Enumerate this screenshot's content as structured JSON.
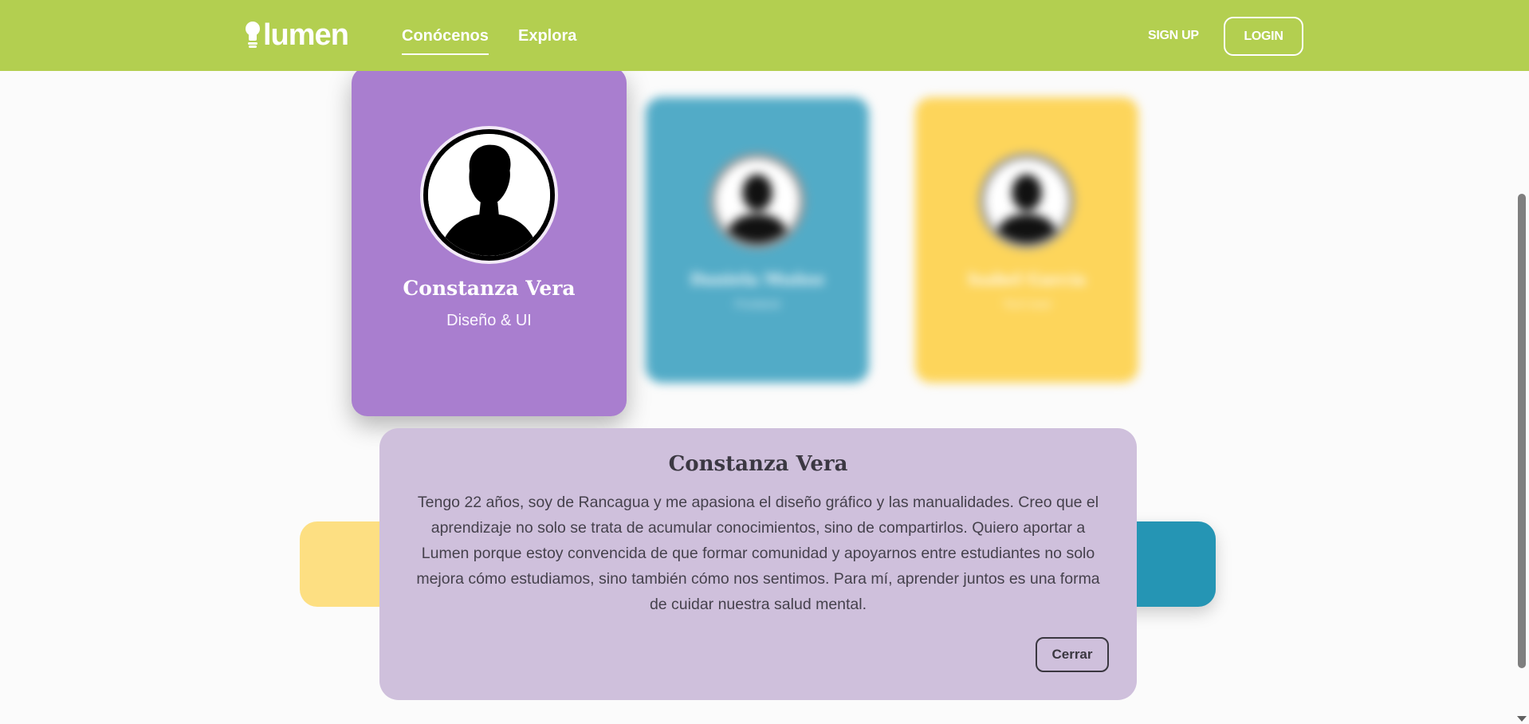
{
  "header": {
    "logo_text": "lumen",
    "nav": [
      {
        "label": "Conócenos",
        "active": true
      },
      {
        "label": "Explora",
        "active": false
      }
    ],
    "signup_label": "SIGN UP",
    "login_label": "LOGIN",
    "color": "#b3cf50"
  },
  "team": [
    {
      "name": "Constanza Vera",
      "role": "Diseño & UI",
      "color": "#a97ecf",
      "selected": true
    },
    {
      "name": "Daniela Muñoz",
      "role": "Frontend",
      "color": "#52abc7",
      "selected": false
    },
    {
      "name": "Isabel García",
      "role": "Tech lead",
      "color": "#fdd55b",
      "selected": false
    }
  ],
  "modal": {
    "title": "Constanza Vera",
    "body": "Tengo 22 años, soy de Rancagua y me apasiona el diseño gráfico y las manualidades. Creo que el aprendizaje no solo se trata de acumular conocimientos, sino de compartirlos. Quiero aportar a Lumen porque estoy convencida de que formar comunidad y apoyarnos entre estudiantes no solo mejora cómo estudiamos, sino también cómo nos sentimos. Para mí, aprender juntos es una forma de cuidar nuestra salud mental.",
    "close_label": "Cerrar",
    "color": "#cfc0dc"
  },
  "icons": {
    "logo": "lightbulb-icon",
    "avatar": "person-silhouette-icon",
    "scroll": "chevron-down-icon"
  }
}
